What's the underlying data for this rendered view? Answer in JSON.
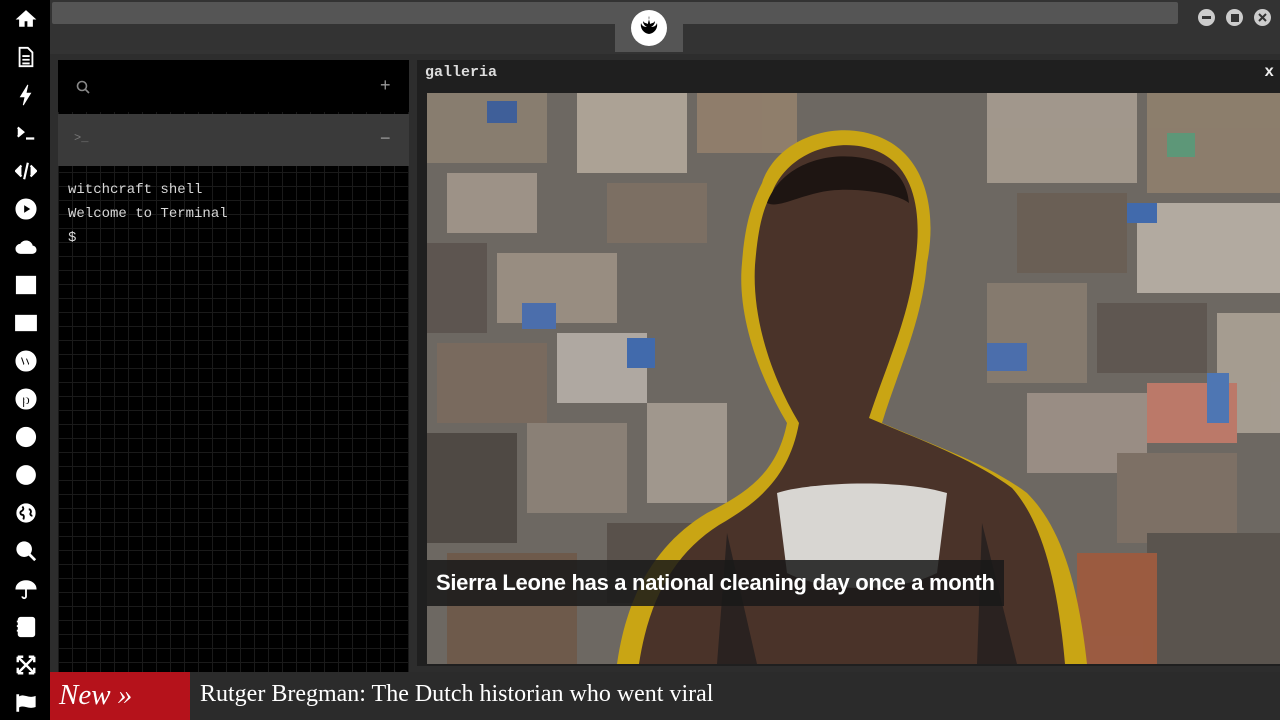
{
  "sidebar": {
    "icons": [
      "home-icon",
      "document-icon",
      "bolt-icon",
      "terminal-icon",
      "code-icon",
      "play-icon",
      "cloud-icon",
      "image-icon",
      "news-icon",
      "wordpress-icon",
      "pinterest-icon",
      "aperture-icon",
      "atom-icon",
      "globe-icon",
      "search-icon",
      "umbrella-icon",
      "contacts-icon",
      "expand-icon",
      "flag-icon"
    ]
  },
  "window": {
    "logo": "rebel-alliance-icon",
    "controls": [
      "minimize",
      "maximize",
      "close"
    ]
  },
  "terminal": {
    "add_label": "+",
    "prompt_icon": ">_",
    "collapse_label": "−",
    "lines": [
      "witchcraft shell",
      "Welcome to Terminal",
      "$"
    ]
  },
  "gallery": {
    "title": "galleria",
    "close_label": "x",
    "caption": "Sierra Leone has a national cleaning day once a month"
  },
  "ticker": {
    "badge": "New »",
    "headline": "Rutger Bregman: The Dutch historian who went viral"
  },
  "colors": {
    "ticker_badge": "#b5121b",
    "sidebar_bg": "#000000",
    "panel_bg": "#2d2d2d",
    "portrait_outline": "#c9a514"
  }
}
